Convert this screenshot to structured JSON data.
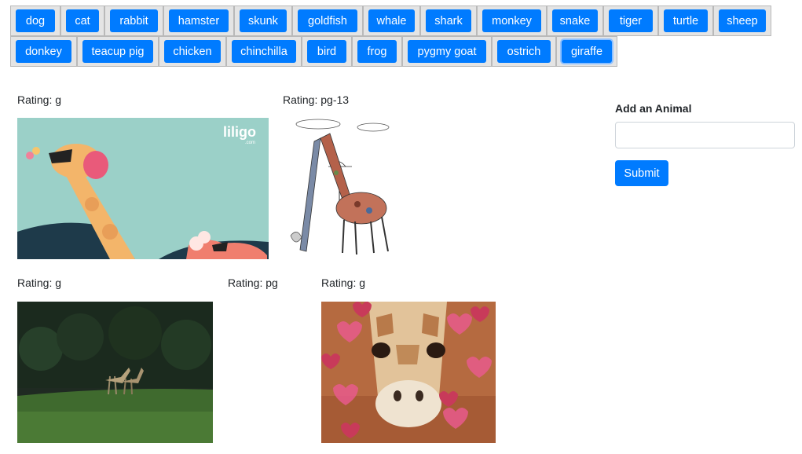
{
  "animals": [
    "dog",
    "cat",
    "rabbit",
    "hamster",
    "skunk",
    "goldfish",
    "whale",
    "shark",
    "monkey",
    "snake",
    "tiger",
    "turtle",
    "sheep",
    "donkey",
    "teacup pig",
    "chicken",
    "chinchilla",
    "bird",
    "frog",
    "pygmy goat",
    "ostrich",
    "giraffe"
  ],
  "active_animal": "giraffe",
  "gifs": [
    {
      "rating": "Rating: g",
      "logo": "liligo",
      "logo_sub": ".com"
    },
    {
      "rating": "Rating: pg-13"
    },
    {
      "rating": "Rating: g"
    },
    {
      "rating": "Rating: pg"
    },
    {
      "rating": "Rating: g"
    }
  ],
  "form": {
    "title": "Add an Animal",
    "input_value": "",
    "submit_label": "Submit"
  },
  "colors": {
    "button_primary": "#007bff",
    "button_wrapper": "#e4e4e4"
  }
}
